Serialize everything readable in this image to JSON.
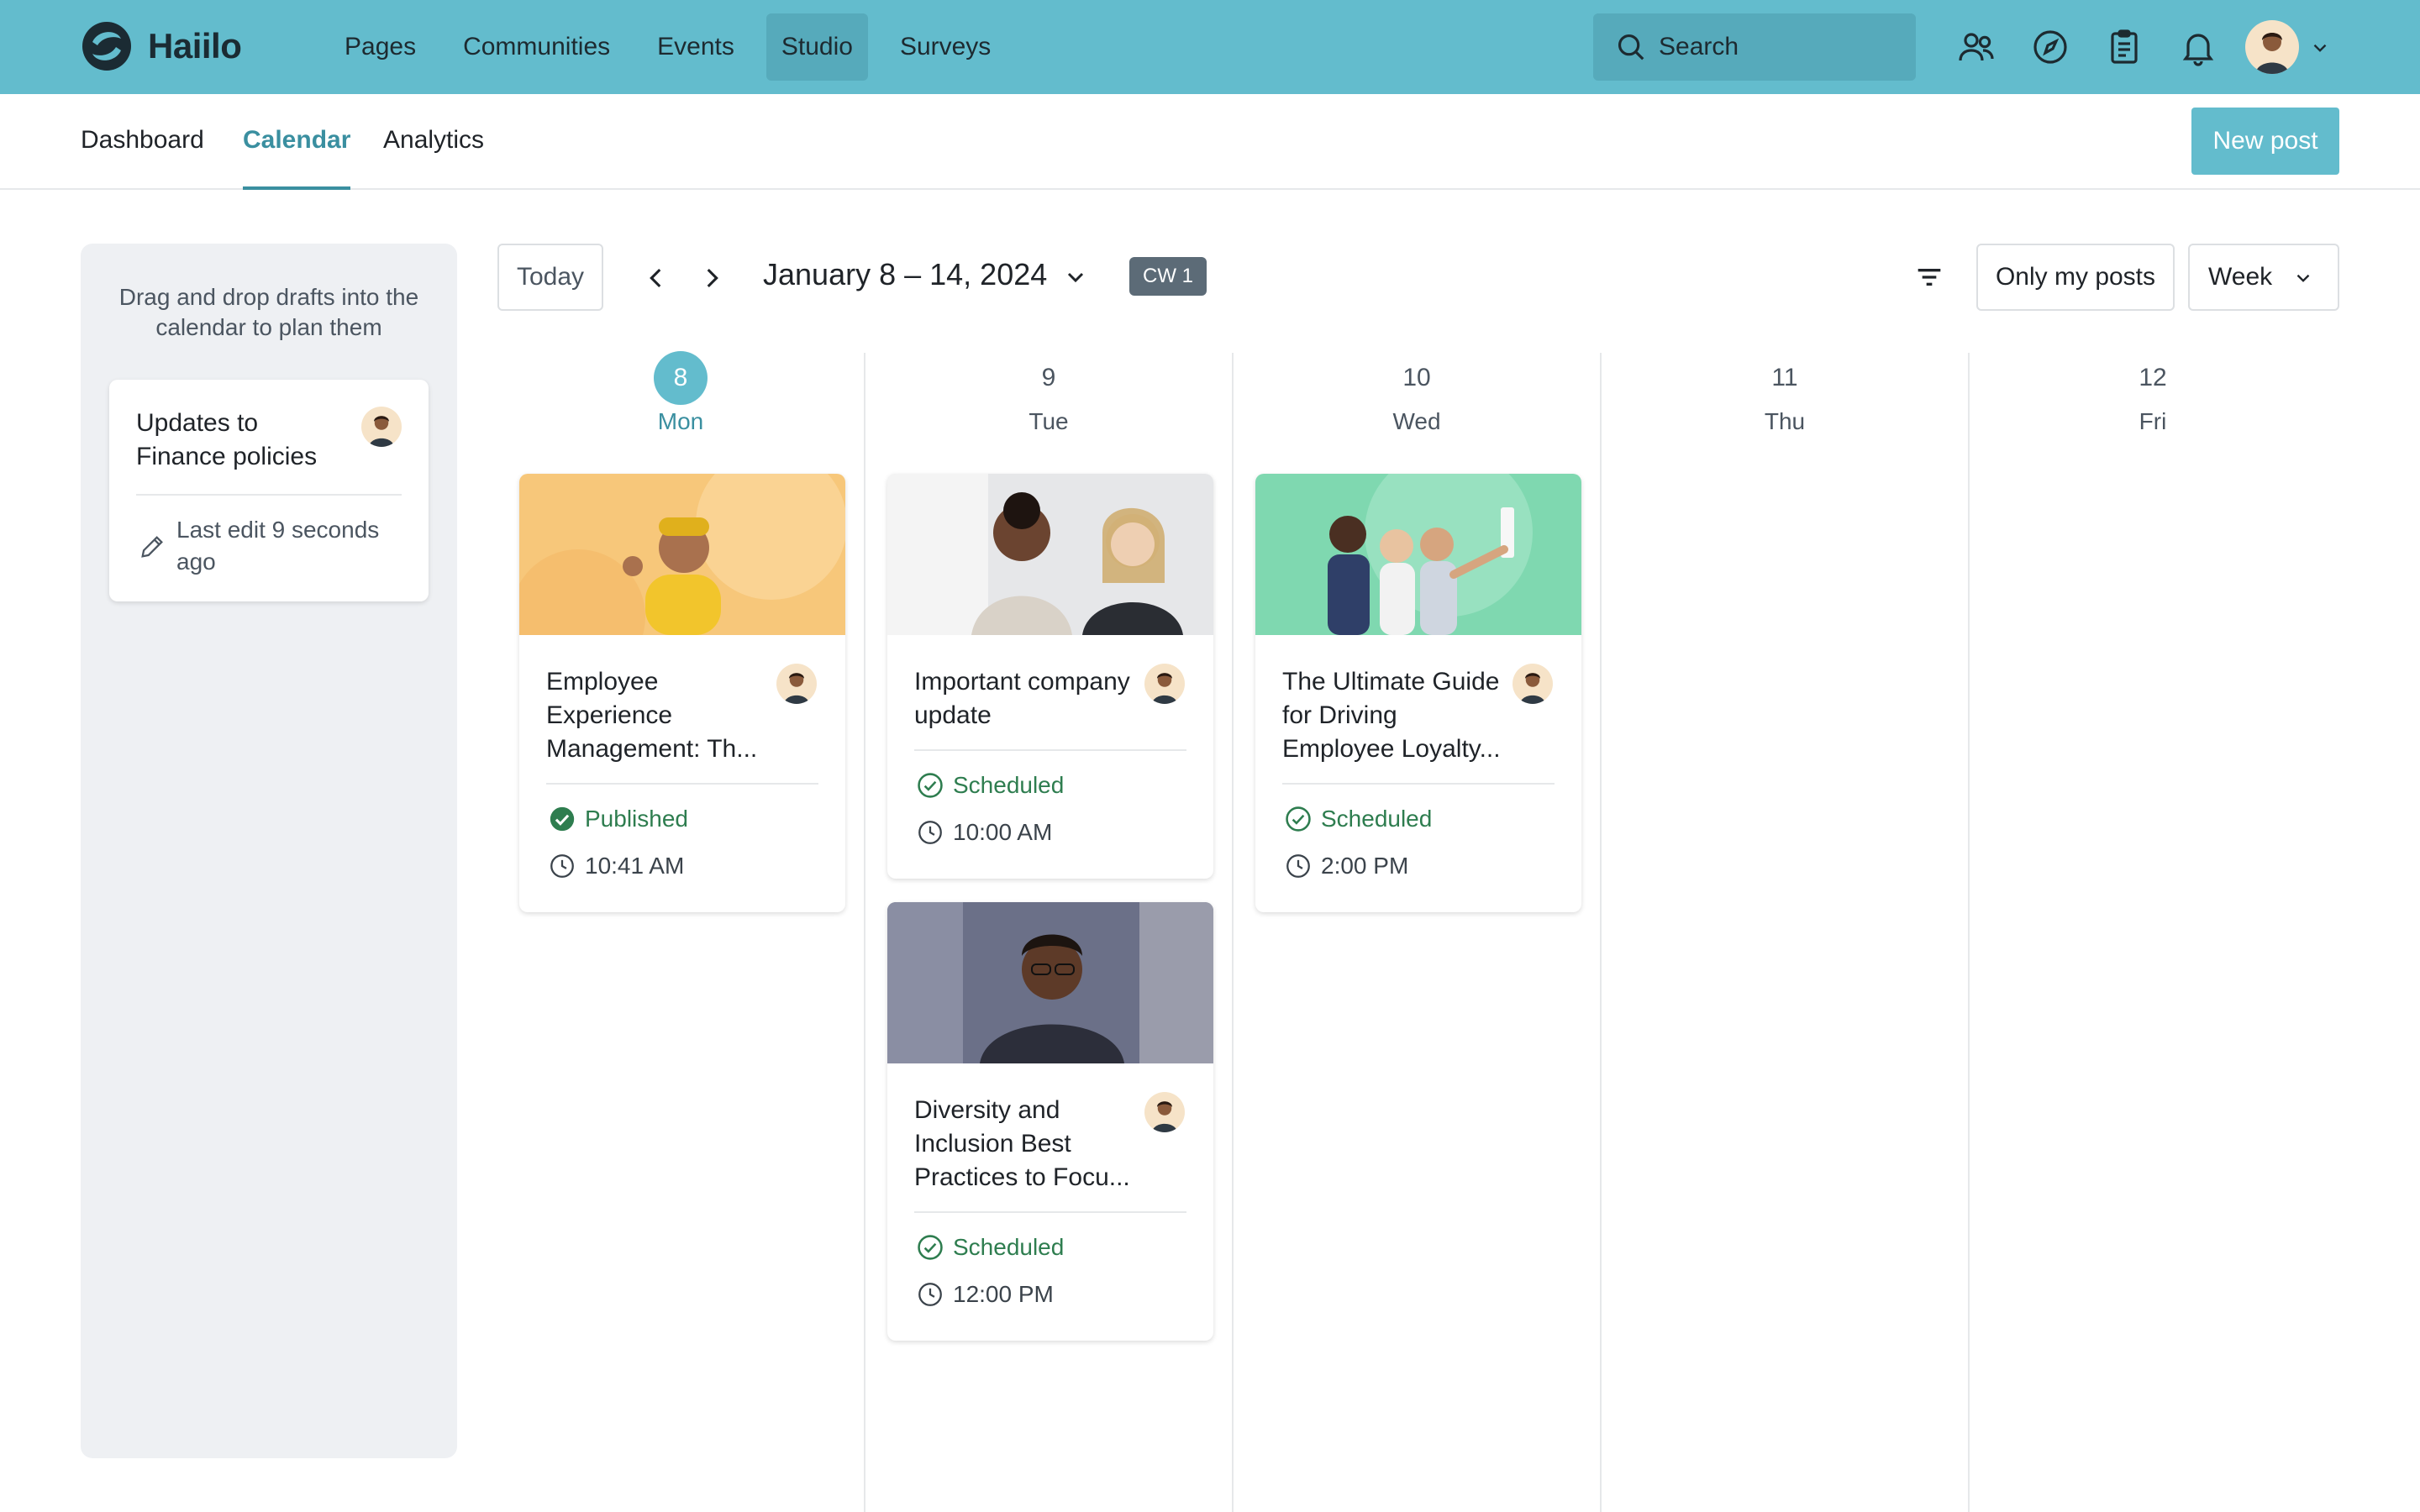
{
  "app": {
    "name": "Haiilo",
    "nav": [
      "Pages",
      "Communities",
      "Events",
      "Studio",
      "Surveys"
    ],
    "active_nav": "Studio",
    "search_placeholder": "Search",
    "icons": [
      "people-icon",
      "compass-icon",
      "clipboard-icon",
      "bell-icon"
    ]
  },
  "subnav": {
    "tabs": [
      "Dashboard",
      "Calendar",
      "Analytics"
    ],
    "active_tab": "Calendar",
    "new_post_label": "New post"
  },
  "sidebar": {
    "hint": "Drag and drop drafts into the calendar to plan them",
    "draft": {
      "title": "Updates to Finance policies",
      "meta": "Last edit 9 seconds ago"
    }
  },
  "calendar": {
    "today_label": "Today",
    "range": "January 8 – 14, 2024",
    "week_badge": "CW 1",
    "only_my_posts_label": "Only my posts",
    "view_label": "Week",
    "days": [
      {
        "num": "8",
        "name": "Mon",
        "is_today": true
      },
      {
        "num": "9",
        "name": "Tue",
        "is_today": false
      },
      {
        "num": "10",
        "name": "Wed",
        "is_today": false
      },
      {
        "num": "11",
        "name": "Thu",
        "is_today": false
      },
      {
        "num": "12",
        "name": "Fri",
        "is_today": false
      }
    ],
    "posts": [
      {
        "title": "Employee Experience Management: Th...",
        "status": "Published",
        "time": "10:41 AM"
      },
      {
        "title": "Important company update",
        "status": "Scheduled",
        "time": "10:00 AM"
      },
      {
        "title": "Diversity and Inclusion Best Practices to Focu...",
        "status": "Scheduled",
        "time": "12:00 PM"
      },
      {
        "title": "The Ultimate Guide for Driving Employee Loyalty...",
        "status": "Scheduled",
        "time": "2:00 PM"
      }
    ]
  },
  "colors": {
    "brand": "#63bccd",
    "accent_text": "#3a8fa0",
    "status_green": "#2e7d4f",
    "badge_gray": "#5c6b77"
  }
}
